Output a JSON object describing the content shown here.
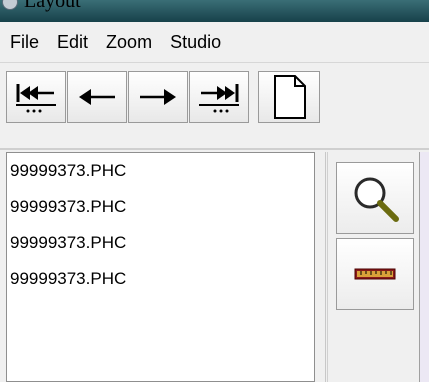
{
  "window": {
    "title": "Layout"
  },
  "menu": [
    "File",
    "Edit",
    "Zoom",
    "Studio"
  ],
  "toolbar": {
    "buttons": [
      {
        "icon": "first-page-icon"
      },
      {
        "icon": "arrow-left-icon"
      },
      {
        "icon": "arrow-right-icon"
      },
      {
        "icon": "last-page-icon"
      },
      {
        "icon": "new-page-icon"
      }
    ]
  },
  "files": [
    "99999373.PHC",
    "99999373.PHC",
    "99999373.PHC",
    "99999373.PHC"
  ],
  "side_tools": [
    {
      "icon": "magnifier-icon"
    },
    {
      "icon": "ruler-icon"
    }
  ]
}
